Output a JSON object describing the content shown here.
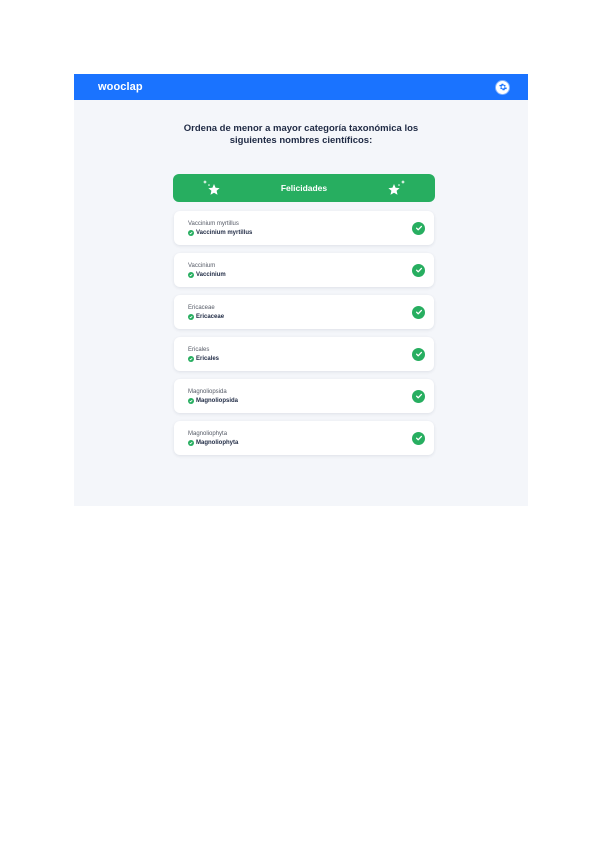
{
  "app": {
    "brand": "wooclap"
  },
  "icons": {
    "settings": "gear-icon",
    "star": "sparkle-star-icon",
    "check": "check-circle-icon"
  },
  "colors": {
    "brand_blue": "#1a73ff",
    "success_green": "#27ae60"
  },
  "question": {
    "text": "Ordena de menor a mayor categoría taxonómica los siguientes nombres científicos:"
  },
  "banner": {
    "label": "Felicidades"
  },
  "items": [
    {
      "answer": "Vaccinium myrtillus",
      "correct": "Vaccinium myrtillus"
    },
    {
      "answer": "Vaccinium",
      "correct": "Vaccinium"
    },
    {
      "answer": "Ericaceae",
      "correct": "Ericaceae"
    },
    {
      "answer": "Ericales",
      "correct": "Ericales"
    },
    {
      "answer": "Magnoliopsida",
      "correct": "Magnoliopsida"
    },
    {
      "answer": "Magnoliophyta",
      "correct": "Magnoliophyta"
    }
  ]
}
